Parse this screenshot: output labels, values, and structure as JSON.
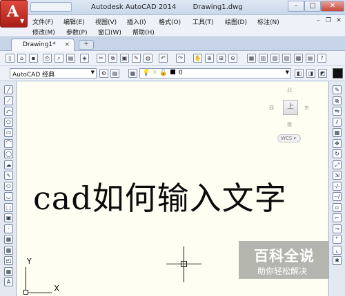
{
  "window": {
    "app_title": "Autodesk AutoCAD 2014",
    "drawing_name": "Drawing1.dwg",
    "app_letter": "A",
    "buttons": {
      "minimize": "–",
      "maximize": "□",
      "close": "✕"
    }
  },
  "menu": {
    "row1": [
      "文件(F)",
      "编辑(E)",
      "视图(V)",
      "插入(I)",
      "格式(O)",
      "工具(T)",
      "绘图(D)",
      "标注(N)"
    ],
    "row2": [
      "修改(M)",
      "参数(P)",
      "窗口(W)",
      "帮助(H)"
    ]
  },
  "tabs": {
    "active": "Drawing1*",
    "close": "×",
    "new": "+"
  },
  "toolbar": {
    "workspace": "AutoCAD 经典",
    "layer_value": "0"
  },
  "viewcube": {
    "north": "北",
    "south": "南",
    "west": "西",
    "east": "东",
    "face": "上",
    "wcs": "WCS ▾"
  },
  "ucs": {
    "x_label": "X",
    "y_label": "Y"
  },
  "canvas_text": "cad如何输入文字",
  "watermark": {
    "brand": "百科全说",
    "slogan": "助你轻松解决"
  },
  "colors": {
    "canvas": "#fffef2",
    "app_button": "#c1271d",
    "accent": "#c7d4e8"
  },
  "icons": {
    "left_toolbar": [
      "line-icon",
      "construction-line-icon",
      "polyline-icon",
      "polygon-icon",
      "rectangle-icon",
      "arc-icon",
      "circle-icon",
      "revision-cloud-icon",
      "spline-icon",
      "ellipse-icon",
      "ellipse-arc-icon",
      "insert-block-icon",
      "make-block-icon",
      "point-icon",
      "hatch-icon",
      "gradient-icon",
      "region-icon",
      "table-icon",
      "mtext-icon"
    ],
    "right_toolbar": [
      "erase-icon",
      "copy-icon",
      "mirror-icon",
      "offset-icon",
      "array-icon",
      "move-icon",
      "rotate-icon",
      "scale-icon",
      "stretch-icon",
      "trim-icon",
      "extend-icon",
      "break-at-point-icon",
      "break-icon",
      "join-icon",
      "chamfer-icon",
      "fillet-icon",
      "explode-icon"
    ]
  }
}
